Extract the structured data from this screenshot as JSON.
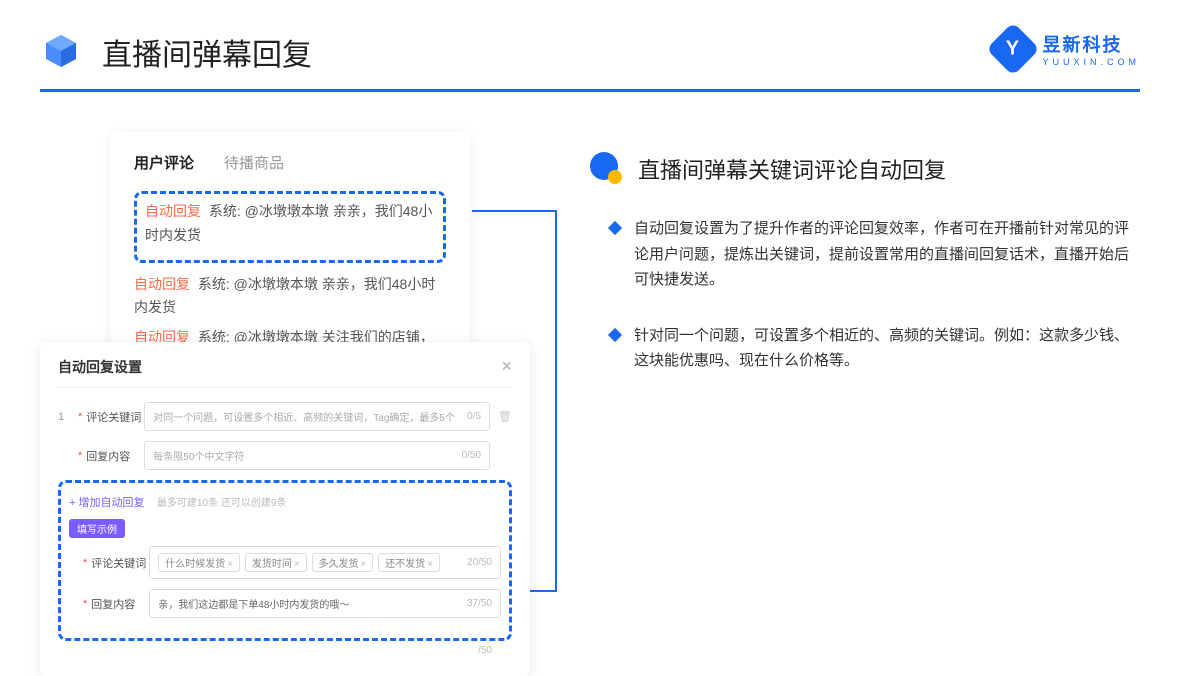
{
  "header": {
    "title": "直播间弹幕回复"
  },
  "brand": {
    "name": "昱新科技",
    "url": "YUUXIN.COM"
  },
  "comments_card": {
    "tabs": {
      "active": "用户评论",
      "inactive": "待播商品"
    },
    "items": [
      {
        "tag": "自动回复",
        "text": "系统: @冰墩墩本墩 亲亲，我们48小时内发货"
      },
      {
        "tag": "自动回复",
        "text": "系统: @冰墩墩本墩 亲亲，我们48小时内发货"
      },
      {
        "tag": "自动回复",
        "text": "系统: @冰墩墩本墩 关注我们的店铺，每日都有热门推荐呦～"
      }
    ]
  },
  "settings": {
    "title": "自动回复设置",
    "row_num": "1",
    "keyword_label": "评论关键词",
    "keyword_placeholder": "对同一个问题，可设置多个相近、高频的关键词，Tag确定，最多5个",
    "keyword_count": "0/5",
    "content_label": "回复内容",
    "content_placeholder": "每条限50个中文字符",
    "content_count": "0/50",
    "add_text": "+ 增加自动回复",
    "add_hint": "最多可建10条 还可以创建9条",
    "example_badge": "填写示例",
    "ex_kw_label": "评论关键词",
    "ex_tags": [
      "什么时候发货",
      "发货时间",
      "多久发货",
      "还不发货"
    ],
    "ex_kw_count": "20/50",
    "ex_content_label": "回复内容",
    "ex_content_value": "亲，我们这边都是下单48小时内发货的哦～",
    "ex_content_count": "37/50",
    "outer_count": "/50"
  },
  "right": {
    "heading": "直播间弹幕关键词评论自动回复",
    "bullets": [
      "自动回复设置为了提升作者的评论回复效率，作者可在开播前针对常见的评论用户问题，提炼出关键词，提前设置常用的直播间回复话术，直播开始后可快捷发送。",
      "针对同一个问题，可设置多个相近的、高频的关键词。例如：这款多少钱、这块能优惠吗、现在什么价格等。"
    ]
  }
}
